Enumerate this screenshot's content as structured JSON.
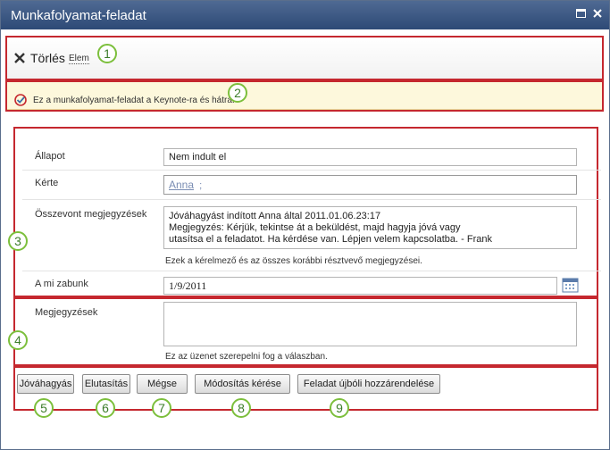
{
  "window": {
    "title": "Munkafolyamat-feladat",
    "maximize_icon": "maximize-icon",
    "close_icon": "close-icon"
  },
  "ribbon": {
    "delete_label": "Törlés",
    "item_label": "Elem",
    "delete_icon": "x-icon"
  },
  "info": {
    "text": "Ez a munkafolyamat-feladat a Keynote-ra és hátra.",
    "icon": "task-check-icon"
  },
  "form": {
    "status_label": "Állapot",
    "status_value": "Nem indult el",
    "requested_by_label": "Kérte",
    "requested_by_value": "Anna",
    "requested_by_sep": ";",
    "combined_comments_label": "Összevont megjegyzések",
    "combined_comments_line1": "Jóváhagyást indított Anna által 2011.01.06.23:17",
    "combined_comments_line2": "Megjegyzés: Kérjük, tekintse át a beküldést, majd hagyja jóvá vagy",
    "combined_comments_line3": "utasítsa el a feladatot. Ha kérdése van. Lépjen velem kapcsolatba. - Frank",
    "combined_comments_note": "Ezek a kérelmező és az összes korábbi résztvevő megjegyzései.",
    "due_date_label": "A mi zabunk",
    "due_date_value": "1/9/2011",
    "calendar_icon": "calendar-icon",
    "comments_label": "Megjegyzések",
    "comments_value": "",
    "comments_note": "Ez az üzenet szerepelni fog a válaszban."
  },
  "buttons": {
    "approve": "Jóváhagyás",
    "reject": "Elutasítás",
    "cancel": "Mégse",
    "request_change": "Módosítás kérése",
    "reassign": "Feladat újbóli hozzárendelése"
  },
  "callouts": [
    "1",
    "2",
    "3",
    "4",
    "5",
    "6",
    "7",
    "8",
    "9"
  ],
  "colors": {
    "titlebar": "#2d4a76",
    "highlight_box": "#c5282f",
    "callout_ring": "#7cbf3c",
    "info_bg": "#fdf8dc",
    "link": "#7a8db3"
  }
}
